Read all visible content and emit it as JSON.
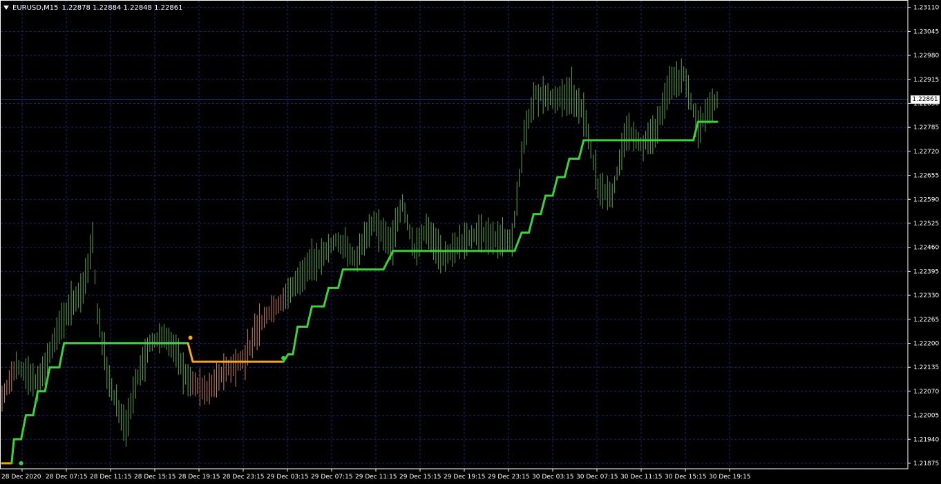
{
  "header": {
    "symbol": "EURUSD,M15",
    "ohlc": "1.22878 1.22884 1.22848 1.22861"
  },
  "current_price_label": "1.22861",
  "colors": {
    "background": "#000000",
    "grid": "#1c2480",
    "axis": "#ffffff",
    "bull_candle": "#5aa845",
    "bear_candle": "#d08060",
    "trail_up": "#3cd23c",
    "trail_down": "#f5a623",
    "price_line": "#2a3a8a"
  },
  "chart_data": {
    "type": "line",
    "instrument": "EURUSD",
    "timeframe": "M15",
    "y_ticks": [
      "1.23110",
      "1.23045",
      "1.22980",
      "1.22915",
      "1.22850",
      "1.22785",
      "1.22720",
      "1.22655",
      "1.22590",
      "1.22525",
      "1.22460",
      "1.22395",
      "1.22330",
      "1.22265",
      "1.22200",
      "1.22135",
      "1.22070",
      "1.22005",
      "1.21940",
      "1.21875"
    ],
    "x_ticks": [
      "28 Dec 2020",
      "28 Dec 07:15",
      "28 Dec 11:15",
      "28 Dec 15:15",
      "28 Dec 19:15",
      "28 Dec 23:15",
      "29 Dec 03:15",
      "29 Dec 07:15",
      "29 Dec 11:15",
      "29 Dec 15:15",
      "29 Dec 19:15",
      "29 Dec 23:15",
      "30 Dec 03:15",
      "30 Dec 07:15",
      "30 Dec 11:15",
      "30 Dec 15:15",
      "30 Dec 19:15"
    ],
    "ylim": [
      1.2186,
      1.2313
    ],
    "grid": true,
    "last_price": 1.22861,
    "price_anchors": [
      [
        0,
        1.2205
      ],
      [
        6,
        1.2214
      ],
      [
        15,
        1.2209
      ],
      [
        25,
        1.2226
      ],
      [
        34,
        1.2235
      ],
      [
        38,
        1.2248
      ],
      [
        40,
        1.2228
      ],
      [
        44,
        1.2212
      ],
      [
        48,
        1.2203
      ],
      [
        52,
        1.2197
      ],
      [
        56,
        1.2209
      ],
      [
        62,
        1.222
      ],
      [
        68,
        1.2222
      ],
      [
        73,
        1.2218
      ],
      [
        78,
        1.221
      ],
      [
        86,
        1.2207
      ],
      [
        94,
        1.2213
      ],
      [
        102,
        1.2216
      ],
      [
        110,
        1.2227
      ],
      [
        117,
        1.2231
      ],
      [
        124,
        1.2237
      ],
      [
        132,
        1.2242
      ],
      [
        140,
        1.2248
      ],
      [
        148,
        1.2243
      ],
      [
        156,
        1.2253
      ],
      [
        163,
        1.2247
      ],
      [
        168,
        1.2258
      ],
      [
        173,
        1.2245
      ],
      [
        178,
        1.2251
      ],
      [
        185,
        1.2243
      ],
      [
        192,
        1.2247
      ],
      [
        200,
        1.225
      ],
      [
        208,
        1.2248
      ],
      [
        214,
        1.2248
      ],
      [
        219,
        1.2276
      ],
      [
        224,
        1.2288
      ],
      [
        232,
        1.2286
      ],
      [
        238,
        1.2287
      ],
      [
        244,
        1.2283
      ],
      [
        250,
        1.2262
      ],
      [
        256,
        1.226
      ],
      [
        262,
        1.2278
      ],
      [
        268,
        1.2274
      ],
      [
        274,
        1.2277
      ],
      [
        280,
        1.229
      ],
      [
        286,
        1.2293
      ],
      [
        292,
        1.2278
      ],
      [
        296,
        1.2283
      ],
      [
        300,
        1.2286
      ]
    ],
    "series": [
      {
        "kind": "trailing_stop",
        "steps": [
          [
            0,
            4,
            1.21875,
            "down"
          ],
          [
            5,
            8,
            1.2194,
            "up"
          ],
          [
            10,
            13,
            1.22005,
            "up"
          ],
          [
            15,
            18,
            1.2207,
            "up"
          ],
          [
            20,
            24,
            1.22135,
            "up"
          ],
          [
            26,
            28,
            1.222,
            "up"
          ],
          [
            28,
            78,
            1.222,
            "up"
          ],
          [
            80,
            118,
            1.2215,
            "down"
          ],
          [
            120,
            122,
            1.2217,
            "up"
          ],
          [
            124,
            128,
            1.22245,
            "up"
          ],
          [
            130,
            135,
            1.223,
            "up"
          ],
          [
            137,
            141,
            1.2235,
            "up"
          ],
          [
            143,
            148,
            1.224,
            "up"
          ],
          [
            150,
            160,
            1.224,
            "up"
          ],
          [
            164,
            215,
            1.2245,
            "up"
          ],
          [
            218,
            221,
            1.225,
            "up"
          ],
          [
            223,
            226,
            1.2255,
            "up"
          ],
          [
            228,
            231,
            1.226,
            "up"
          ],
          [
            233,
            236,
            1.2265,
            "up"
          ],
          [
            238,
            242,
            1.227,
            "up"
          ],
          [
            244,
            290,
            1.2275,
            "up"
          ],
          [
            292,
            300,
            1.228,
            "up"
          ]
        ]
      }
    ],
    "signal_dots": [
      [
        8,
        1.21875,
        "up"
      ],
      [
        79,
        1.22215,
        "down"
      ],
      [
        118,
        1.2216,
        "up"
      ]
    ]
  }
}
